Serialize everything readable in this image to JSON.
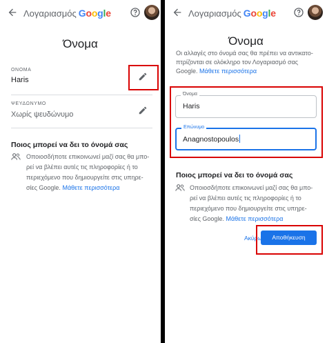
{
  "app_header": {
    "title_prefix": "Λογαριασμός",
    "google_letters": [
      "G",
      "o",
      "o",
      "g",
      "l",
      "e"
    ],
    "back_icon": "arrow-back-icon",
    "help_icon": "help-circle-icon"
  },
  "left": {
    "heading": "Όνομα",
    "name_field": {
      "label": "ΟΝΟΜΑ",
      "value": "Haris",
      "edit_icon": "pencil-icon"
    },
    "nickname_field": {
      "label": "ΨΕΥΔΩΝΥΜΟ",
      "value": "Χωρίς ψευδώνυμο",
      "edit_icon": "pencil-icon"
    },
    "visibility": {
      "title": "Ποιος μπορεί να δει το όνομά σας",
      "lines": [
        "Οποιοσδήποτε επικοινωνεί μαζί σας θα μπο-",
        "ρεί να βλέπει αυτές τις πληροφορίες ή το",
        "περιεχόμενο που δημιουργείτε στις υπηρε-"
      ],
      "last_line": "σίες Google.",
      "link": "Μάθετε περισσότερα"
    }
  },
  "right": {
    "heading": "Όνομα",
    "notice_lines": [
      "Οι αλλαγές στο όνομά σας θα πρέπει να αντικατο-",
      "πτρίζονται σε ολόκληρο τον Λογαριασμό σας"
    ],
    "notice_last_line": "Google.",
    "notice_link": "Μάθετε περισσότερα",
    "first_name": {
      "label": "Όνομα",
      "value": "Haris"
    },
    "last_name": {
      "label": "Επώνυμο",
      "value": "Anagnostopoulos"
    },
    "visibility": {
      "title": "Ποιος μπορεί να δει το όνομά σας",
      "lines": [
        "Οποιοσδήποτε επικοινωνεί μαζί σας θα μπο-",
        "ρεί να βλέπει αυτές τις πληροφορίες ή το",
        "περιεχόμενο που δημιουργείτε στις υπηρε-"
      ],
      "last_line": "σίες Google.",
      "link": "Μάθετε περισσότερα"
    },
    "cancel_label": "Ακύρωση",
    "save_label": "Αποθήκευση"
  },
  "colors": {
    "accent": "#1a73e8",
    "highlight": "#d90000",
    "separator": "#000000"
  }
}
